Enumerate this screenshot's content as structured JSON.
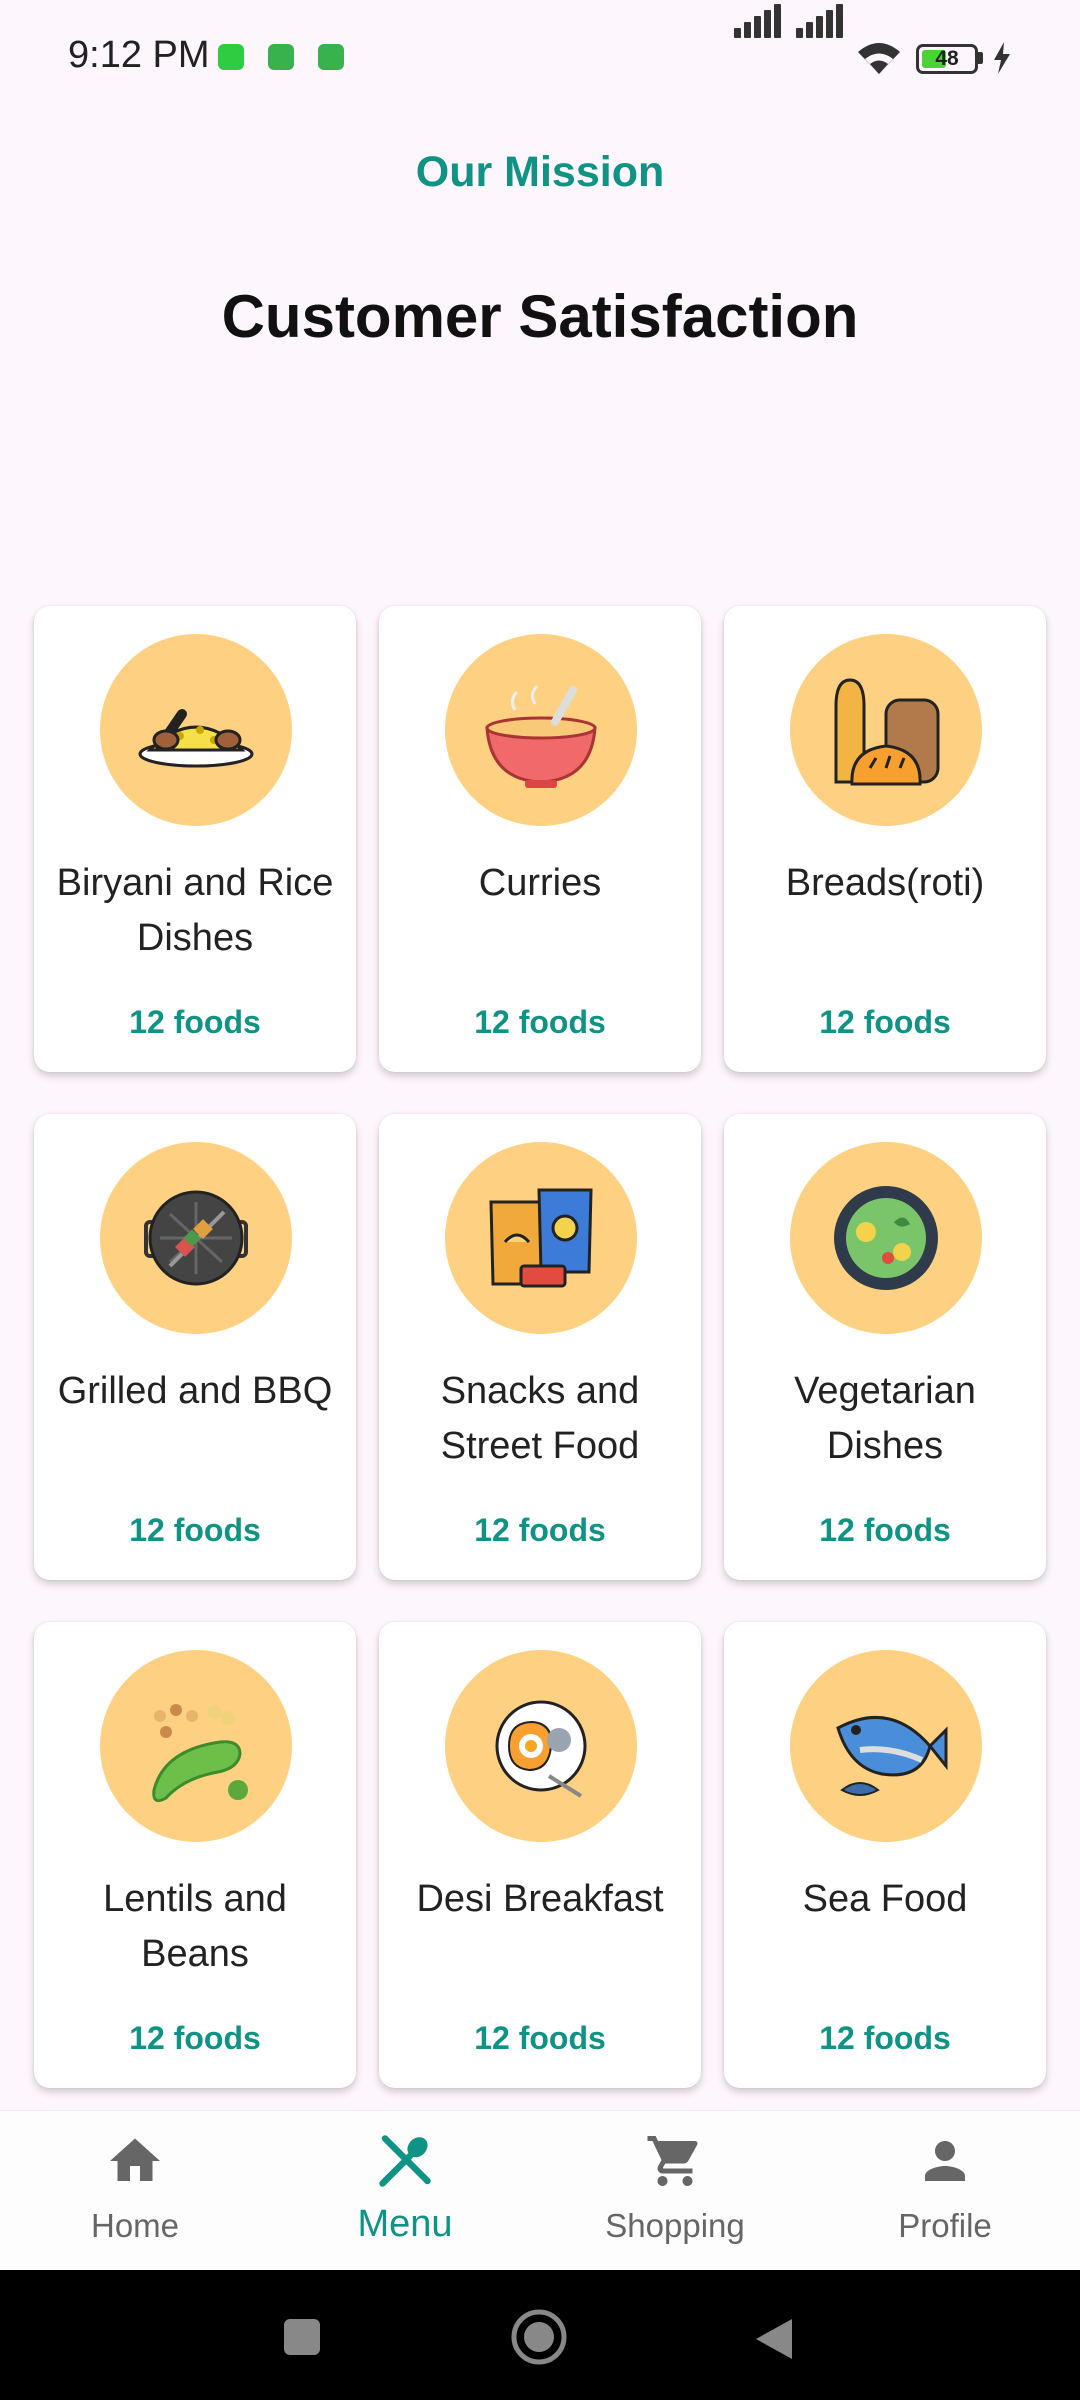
{
  "status_bar": {
    "time": "9:12 PM",
    "battery": "48",
    "battery_level": 0.48,
    "icons": [
      "whatsapp-icon",
      "android-app-icon",
      "android-app-icon",
      "signal-icon",
      "signal-icon",
      "wifi-icon",
      "battery-icon",
      "charging-icon"
    ]
  },
  "header": {
    "mission": "Our Mission",
    "headline": "Customer Satisfaction"
  },
  "categories": [
    {
      "name": "Biryani and Rice Dishes",
      "count": "12 foods",
      "icon": "biryani-icon"
    },
    {
      "name": "Curries",
      "count": "12 foods",
      "icon": "curry-bowl-icon"
    },
    {
      "name": "Breads(roti)",
      "count": "12 foods",
      "icon": "bread-icon"
    },
    {
      "name": "Grilled and BBQ",
      "count": "12 foods",
      "icon": "grill-icon"
    },
    {
      "name": "Snacks and Street Food",
      "count": "12 foods",
      "icon": "snacks-icon"
    },
    {
      "name": "Vegetarian Dishes",
      "count": "12 foods",
      "icon": "vegetable-bowl-icon"
    },
    {
      "name": "Lentils and Beans",
      "count": "12 foods",
      "icon": "beans-icon"
    },
    {
      "name": "Desi Breakfast",
      "count": "12 foods",
      "icon": "breakfast-plate-icon"
    },
    {
      "name": "Sea Food",
      "count": "12 foods",
      "icon": "fish-icon"
    }
  ],
  "bottom_nav": [
    {
      "label": "Home",
      "icon": "home-icon",
      "active": false
    },
    {
      "label": "Menu",
      "icon": "menu-utensils-icon",
      "active": true
    },
    {
      "label": "Shopping",
      "icon": "cart-icon",
      "active": false
    },
    {
      "label": "Profile",
      "icon": "profile-icon",
      "active": false
    }
  ],
  "colors": {
    "accent": "#0f9384",
    "background": "#fdf6fc",
    "icon_circle": "#fdd181"
  }
}
